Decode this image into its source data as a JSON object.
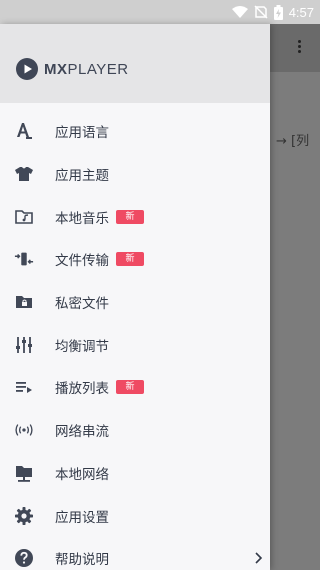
{
  "status_bar": {
    "time": "4:57"
  },
  "app": {
    "logo_text": "MXPLAYER"
  },
  "background": {
    "visible_text": "→ [列"
  },
  "menu": [
    {
      "label": "应用语言",
      "icon": "language-icon",
      "badge": ""
    },
    {
      "label": "应用主题",
      "icon": "theme-shirt-icon",
      "badge": ""
    },
    {
      "label": "本地音乐",
      "icon": "local-music-folder-icon",
      "badge": "新"
    },
    {
      "label": "文件传输",
      "icon": "file-transfer-icon",
      "badge": "新"
    },
    {
      "label": "私密文件",
      "icon": "private-folder-icon",
      "badge": ""
    },
    {
      "label": "均衡调节",
      "icon": "equalizer-icon",
      "badge": ""
    },
    {
      "label": "播放列表",
      "icon": "playlist-icon",
      "badge": "新"
    },
    {
      "label": "网络串流",
      "icon": "network-stream-icon",
      "badge": ""
    },
    {
      "label": "本地网络",
      "icon": "local-network-icon",
      "badge": ""
    },
    {
      "label": "应用设置",
      "icon": "settings-gear-icon",
      "badge": ""
    },
    {
      "label": "帮助说明",
      "icon": "help-icon",
      "badge": ""
    }
  ],
  "colors": {
    "icon": "#414857",
    "badge": "#ef4a63",
    "drawer_bg": "#f7f7f9",
    "header_bg": "#e5e5e7"
  }
}
